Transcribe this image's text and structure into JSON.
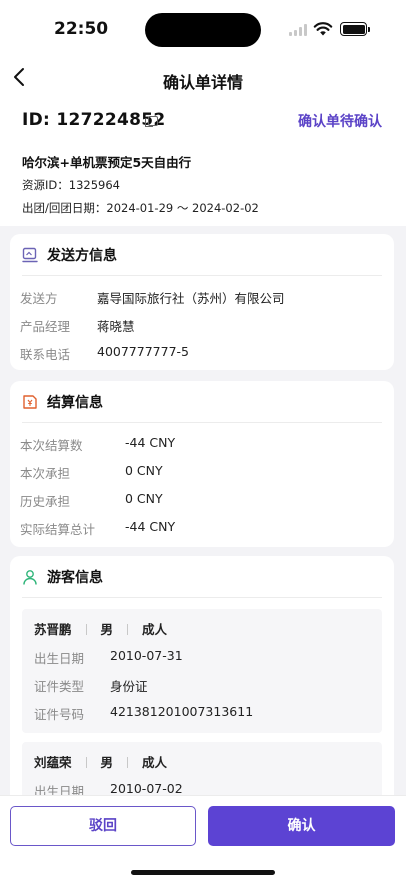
{
  "status_bar": {
    "time": "22:50"
  },
  "nav": {
    "title": "确认单详情"
  },
  "order": {
    "id_text": "ID: 127224852",
    "status": "确认单待确认",
    "product_name": "哈尔滨+单机票预定5天自由行",
    "resource_id": "资源ID：1325964",
    "dates": "出团/回团日期：2024-01-29 ～ 2024-02-02"
  },
  "sender": {
    "title": "发送方信息",
    "rows": [
      {
        "label": "发送方",
        "value": "嘉导国际旅行社（苏州）有限公司"
      },
      {
        "label": "产品经理",
        "value": "蒋晓慧"
      },
      {
        "label": "联系电话",
        "value": "4007777777-5"
      }
    ]
  },
  "settlement": {
    "title": "结算信息",
    "rows": [
      {
        "label": "本次结算数",
        "value": "-44 CNY"
      },
      {
        "label": "本次承担",
        "value": "0 CNY"
      },
      {
        "label": "历史承担",
        "value": "0 CNY"
      },
      {
        "label": "实际结算总计",
        "value": "-44 CNY"
      }
    ]
  },
  "travelers": {
    "title": "游客信息",
    "list": [
      {
        "name": "苏晋鹏",
        "gender": "男",
        "type": "成人",
        "rows": [
          {
            "label": "出生日期",
            "value": "2010-07-31"
          },
          {
            "label": "证件类型",
            "value": "身份证"
          },
          {
            "label": "证件号码",
            "value": "421381201007313611"
          }
        ]
      },
      {
        "name": "刘蕴荣",
        "gender": "男",
        "type": "成人",
        "rows": [
          {
            "label": "出生日期",
            "value": "2010-07-02"
          }
        ]
      }
    ]
  },
  "actions": {
    "reject": "驳回",
    "confirm": "确认"
  },
  "colors": {
    "accent": "#5c43d3",
    "icon_orange": "#e0612f",
    "icon_green": "#2fb57a",
    "icon_purple": "#6b63b5"
  }
}
